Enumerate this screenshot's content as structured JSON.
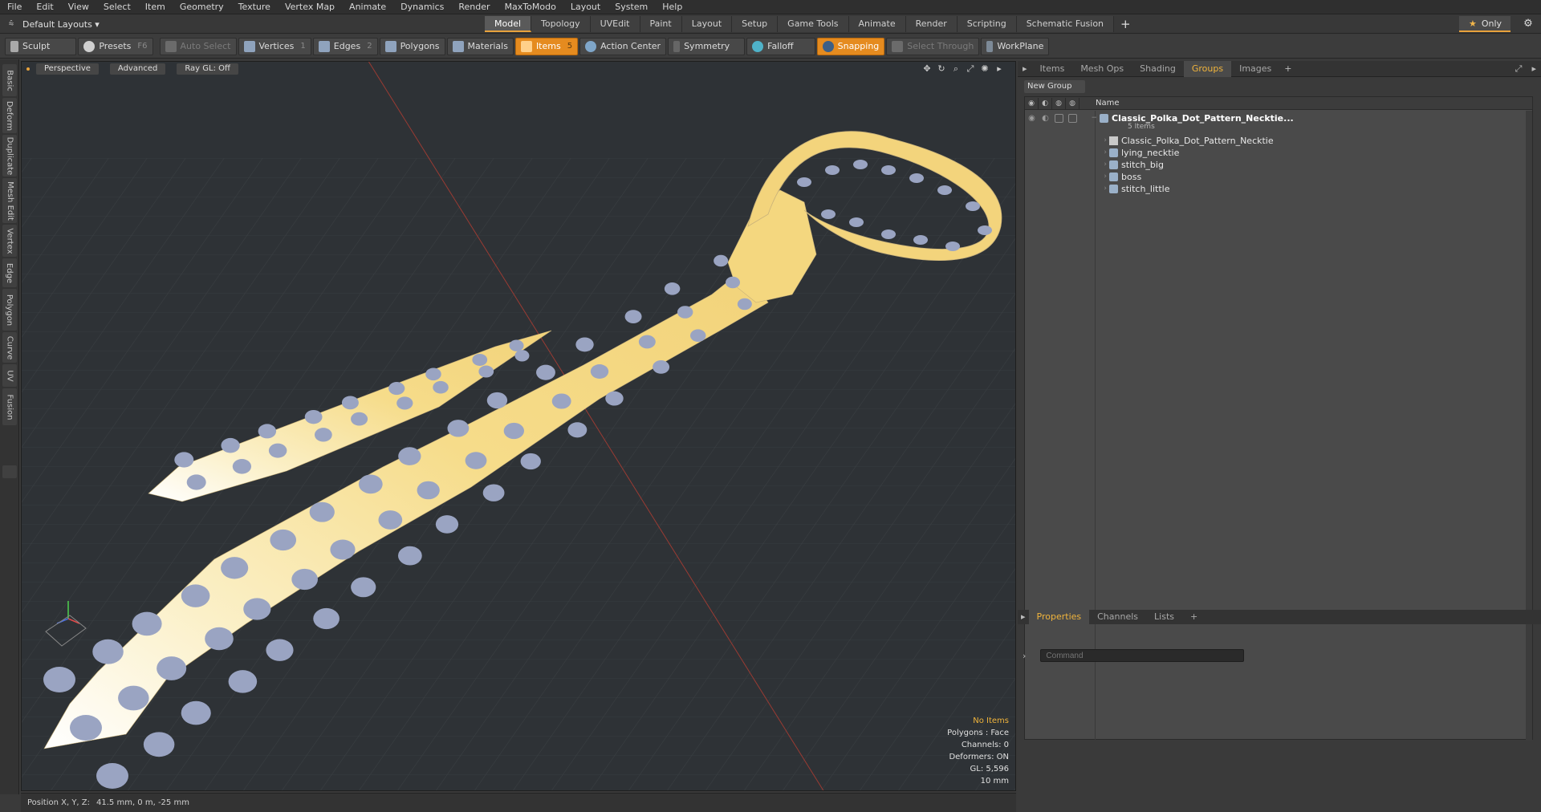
{
  "menu": [
    "File",
    "Edit",
    "View",
    "Select",
    "Item",
    "Geometry",
    "Texture",
    "Vertex Map",
    "Animate",
    "Dynamics",
    "Render",
    "MaxToModo",
    "Layout",
    "System",
    "Help"
  ],
  "layout": {
    "label": "Default Layouts ▾"
  },
  "tabs": [
    "Model",
    "Topology",
    "UVEdit",
    "Paint",
    "Layout",
    "Setup",
    "Game Tools",
    "Animate",
    "Render",
    "Scripting",
    "Schematic Fusion"
  ],
  "tabs_active": "Model",
  "only_label": "Only",
  "toolbar": {
    "sculpt": "Sculpt",
    "presets": "Presets",
    "presets_key": "F6",
    "auto_select": "Auto Select",
    "vertices": "Vertices",
    "vertices_n": "1",
    "edges": "Edges",
    "edges_n": "2",
    "polygons": "Polygons",
    "materials": "Materials",
    "items": "Items",
    "items_n": "5",
    "action_center": "Action Center",
    "symmetry": "Symmetry",
    "falloff": "Falloff",
    "snapping": "Snapping",
    "select_through": "Select Through",
    "workplane": "WorkPlane"
  },
  "left_tabs": [
    "Basic",
    "Deform",
    "Duplicate",
    "Mesh Edit",
    "Vertex",
    "Edge",
    "Polygon",
    "Curve",
    "UV",
    "Fusion"
  ],
  "viewport": {
    "perspective": "Perspective",
    "advanced": "Advanced",
    "raygl": "Ray GL: Off",
    "info": {
      "no_items": "No Items",
      "polygons": "Polygons : Face",
      "channels": "Channels: 0",
      "deformers": "Deformers: ON",
      "gl": "GL: 5,596",
      "scale": "10 mm"
    }
  },
  "right_tabs": [
    "Items",
    "Mesh Ops",
    "Shading",
    "Groups",
    "Images"
  ],
  "right_tabs_active": "Groups",
  "groups": {
    "new_group": "New Group",
    "col_name": "Name",
    "root": {
      "name": "Classic_Polka_Dot_Pattern_Necktie...",
      "count": "5 Items"
    },
    "children": [
      "Classic_Polka_Dot_Pattern_Necktie",
      "lying_necktie",
      "stitch_big",
      "boss",
      "stitch_little"
    ]
  },
  "bottom_tabs": [
    "Properties",
    "Channels",
    "Lists"
  ],
  "bottom_tabs_active": "Properties",
  "command_placeholder": "Command",
  "status": {
    "label": "Position X, Y, Z:",
    "value": "41.5 mm, 0 m, -25 mm"
  },
  "colors": {
    "accent": "#e8a23c",
    "tie": "#f6dc8a",
    "dots": "#9aa4c2"
  }
}
